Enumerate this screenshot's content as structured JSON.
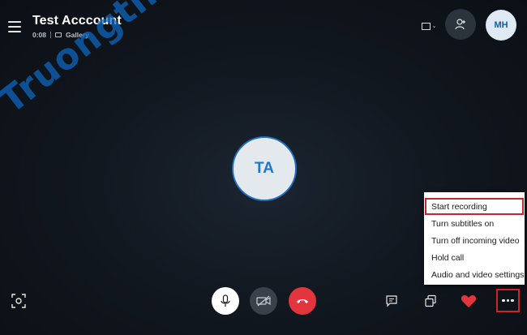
{
  "header": {
    "title": "Test Acccount",
    "duration": "0:08",
    "view_mode": "Gallery",
    "my_avatar_initials": "MH"
  },
  "main": {
    "participant_initials": "TA"
  },
  "watermark": {
    "text": "Truongtin.top"
  },
  "more_menu": {
    "items": [
      {
        "label": "Start recording",
        "highlighted": true
      },
      {
        "label": "Turn subtitles on"
      },
      {
        "label": "Turn off incoming video"
      },
      {
        "label": "Hold call"
      },
      {
        "label": "Audio and video settings"
      }
    ]
  },
  "icons": {
    "menu": "hamburger-icon",
    "gallery": "gallery-icon",
    "layout": "layout-icon",
    "add_people": "add-person-icon",
    "screenshot": "screenshot-icon",
    "mic": "microphone-icon",
    "video": "video-off-icon",
    "hangup": "hang-up-icon",
    "chat": "chat-icon",
    "share": "share-screen-icon",
    "react": "heart-icon",
    "more": "more-icon"
  },
  "colors": {
    "hangup": "#e3353d",
    "heart": "#e3353d",
    "highlight_box": "#c8252c",
    "avatar_text": "#2377c6",
    "watermark": "#0e68c4"
  }
}
